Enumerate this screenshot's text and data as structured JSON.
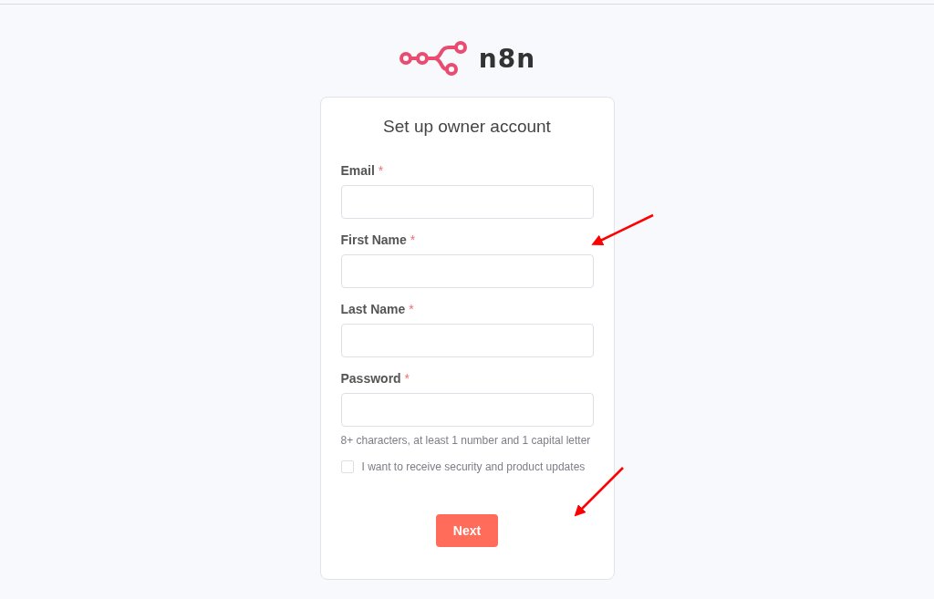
{
  "logo": {
    "wordmark": "n8n"
  },
  "card": {
    "title": "Set up owner account",
    "fields": [
      {
        "label": "Email",
        "required_mark": "*"
      },
      {
        "label": "First Name",
        "required_mark": "*"
      },
      {
        "label": "Last Name",
        "required_mark": "*"
      },
      {
        "label": "Password",
        "required_mark": "*",
        "hint": "8+ characters, at least 1 number and 1 capital letter"
      }
    ],
    "checkbox": {
      "label": "I want to receive security and product updates",
      "checked": false
    },
    "button": "Next"
  }
}
